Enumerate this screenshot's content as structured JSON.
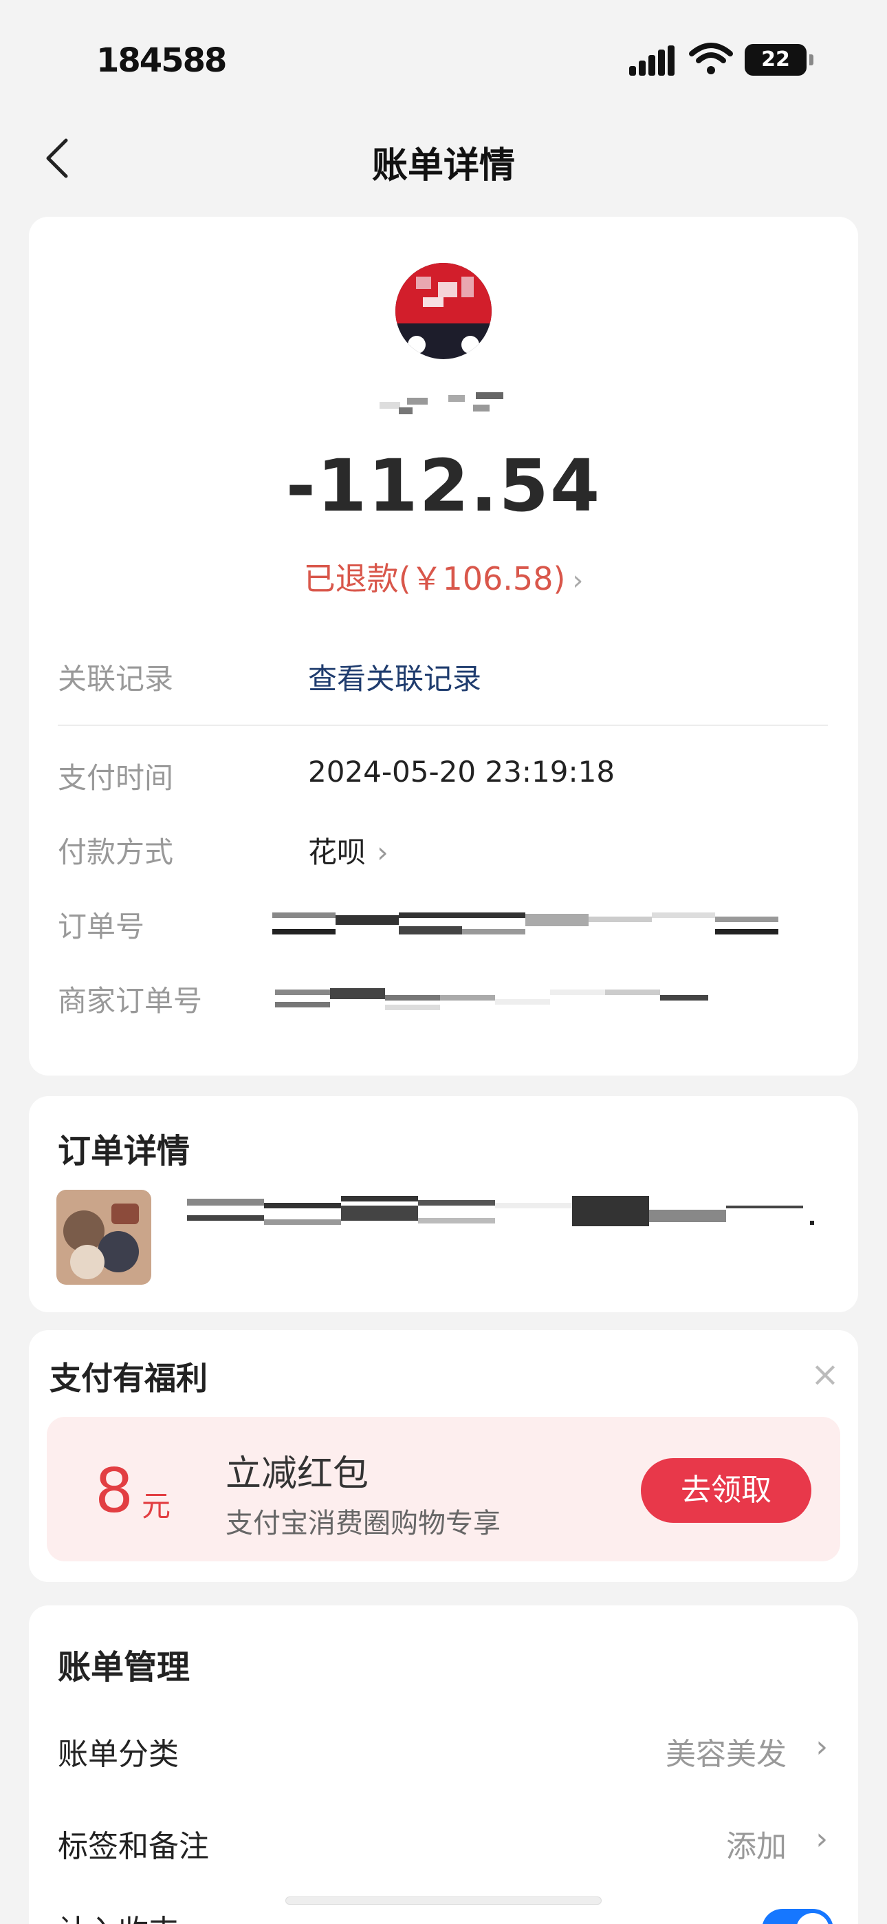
{
  "status_bar": {
    "time": "184588",
    "battery": "22"
  },
  "nav": {
    "title": "账单详情"
  },
  "bill": {
    "amount": "-112.54",
    "refund_text": "已退款(￥106.58)",
    "rows": {
      "related": {
        "label": "关联记录",
        "value": "查看关联记录"
      },
      "pay_time": {
        "label": "支付时间",
        "value": "2024-05-20 23:19:18"
      },
      "pay_method": {
        "label": "付款方式",
        "value": "花呗"
      },
      "order_no": {
        "label": "订单号"
      },
      "merchant_order_no": {
        "label": "商家订单号"
      }
    }
  },
  "order_detail": {
    "title": "订单详情"
  },
  "benefit": {
    "title": "支付有福利",
    "amount": "8",
    "unit": "元",
    "promo_title": "立减红包",
    "promo_subtitle": "支付宝消费圈购物专享",
    "button": "去领取"
  },
  "management": {
    "title": "账单管理",
    "category_label": "账单分类",
    "category_value": "美容美发",
    "tag_label": "标签和备注",
    "tag_value": "添加",
    "income_label": "计入收支"
  },
  "icons": {
    "back": "chevron-left-icon",
    "chevron": "chevron-right-icon",
    "close": "close-icon"
  },
  "colors": {
    "accent": "#d9574b",
    "link": "#1f3c6e",
    "promo_button": "#e8384a",
    "toggle": "#1677ff"
  }
}
